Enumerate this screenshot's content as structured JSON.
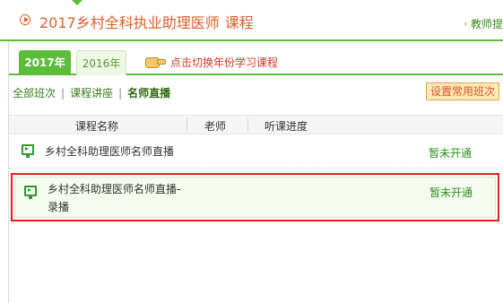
{
  "header": {
    "title_main": "2017乡村全科执业助理医师",
    "title_suffix": "课程",
    "teacher_link": "· 教师提"
  },
  "year_tabs": [
    {
      "label": "2017年",
      "active": true
    },
    {
      "label": "2016年",
      "active": false
    }
  ],
  "hint": "点击切换年份学习课程",
  "subnav": {
    "items": [
      "全部班次",
      "课程讲座",
      "名师直播"
    ],
    "separator": "|",
    "current_index": 2
  },
  "settings_button": "设置常用班次",
  "table": {
    "columns": [
      "课程名称",
      "老师",
      "听课进度"
    ],
    "rows": [
      {
        "name": "乡村全科助理医师名师直播",
        "name_line2": "",
        "status": "暂未开通"
      },
      {
        "name": "乡村全科助理医师名师直播-",
        "name_line2": "录播",
        "status": "暂未开通"
      }
    ]
  },
  "colors": {
    "accent_green": "#5bbd3a",
    "title_orange": "#e0602a",
    "highlight_red": "#e02020",
    "status_green": "#2f8f1f"
  },
  "icons": {
    "title_icon": "play-circle-icon",
    "hint_icon": "pointing-hand-icon",
    "row_icon": "video-monitor-icon"
  }
}
